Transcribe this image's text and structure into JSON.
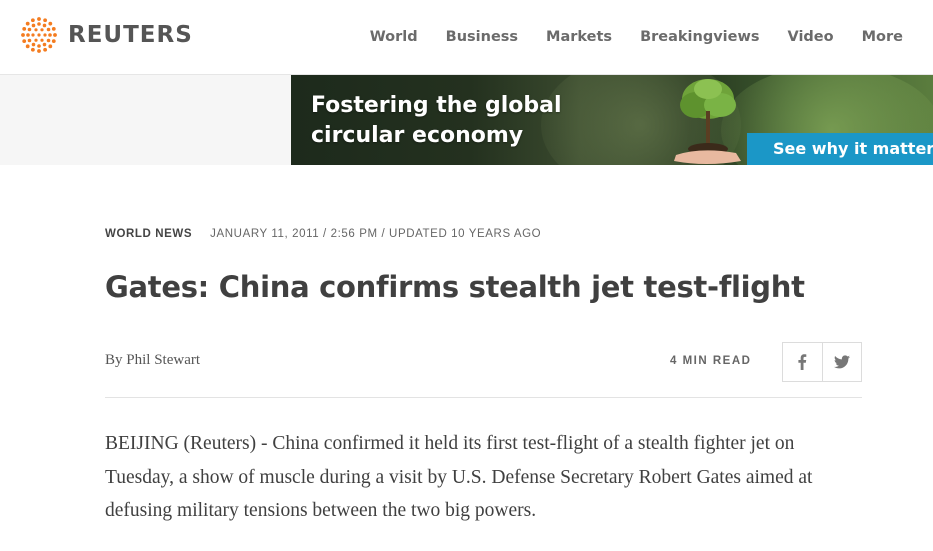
{
  "header": {
    "logo_text": "REUTERS",
    "logo_icon": "reuters-dots-logo-icon",
    "nav": [
      "World",
      "Business",
      "Markets",
      "Breakingviews",
      "Video",
      "More"
    ]
  },
  "ad": {
    "headline": "Fostering the global circular economy",
    "cta": "See why it matters",
    "image_icon": "tree-in-hands-image",
    "colors": {
      "cta_bg": "#1b97c7"
    }
  },
  "article": {
    "section": "WORLD NEWS",
    "date": "JANUARY 11, 2011 / 2:56 PM / UPDATED 10 YEARS AGO",
    "title": "Gates: China confirms stealth jet test-flight",
    "byline_prefix": "By",
    "author": "Phil Stewart",
    "read_time": "4 MIN READ",
    "share": [
      "facebook-icon",
      "twitter-icon"
    ],
    "body": "BEIJING (Reuters) - China confirmed it held its first test-flight of a stealth fighter jet on Tuesday, a show of muscle during a visit by U.S. Defense Secretary Robert Gates aimed at defusing military tensions between the two big powers."
  },
  "colors": {
    "logo_orange": "#f47c20",
    "text": "#404040",
    "nav": "#6b6b6b"
  }
}
